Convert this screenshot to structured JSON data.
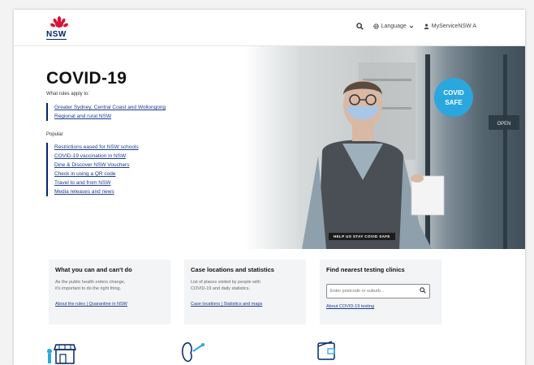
{
  "header": {
    "logo_text": "NSW",
    "language_label": "Language",
    "account_label": "MyServiceNSW A"
  },
  "hero": {
    "title": "COVID-19",
    "rules_heading": "What rules apply to:",
    "rules_links": [
      "Greater Sydney, Central Coast and Wollongong",
      "Regional and rural NSW"
    ],
    "popular_heading": "Popular",
    "popular_links": [
      "Restrictions eased for NSW schools",
      "COVID-19 vaccination in NSW",
      "Dine & Discover NSW Vouchers",
      "Check in using a QR code",
      "Travel to and from NSW",
      "Media releases and news"
    ],
    "badge_text": "HELP US STAY COVID SAFE",
    "sign_text": "COVID SAFE",
    "open_sign": "OPEN"
  },
  "cards": [
    {
      "title": "What you can and can't do",
      "text_lines": [
        "As the public health orders change,",
        "it's important to do the right thing."
      ],
      "links": "About the rules | Quarantine in NSW"
    },
    {
      "title": "Case locations and statistics",
      "text_lines": [
        "List of places visited by people with",
        "COVID-19 and daily statistics."
      ],
      "links": "Case locations | Statistics and maps"
    },
    {
      "title": "Find nearest testing clinics",
      "search_placeholder": "Enter postcode or suburb...",
      "links": "About COVID-19 testing"
    }
  ],
  "colors": {
    "navy": "#002664",
    "red": "#d7153a",
    "link": "#1c3a8a"
  },
  "icons": [
    "search-icon",
    "globe-icon",
    "person-icon",
    "waratah-icon",
    "shop-icon",
    "virus-icon",
    "wallet-icon"
  ]
}
